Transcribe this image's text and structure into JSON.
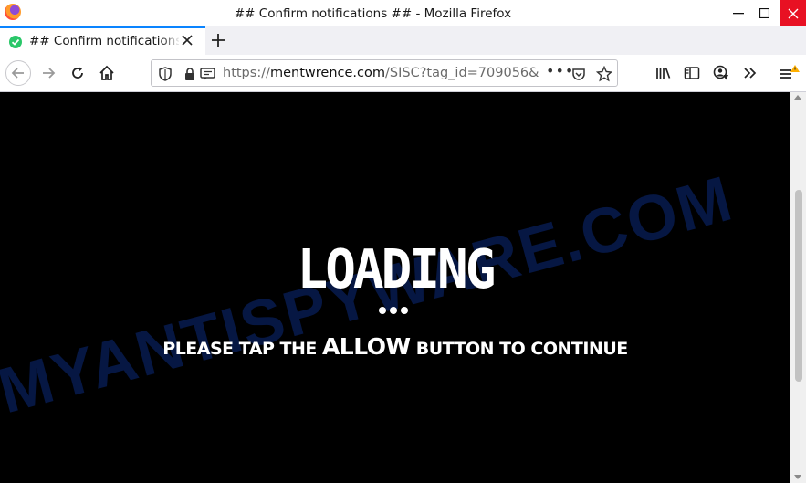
{
  "window": {
    "title": "## Confirm notifications ## - Mozilla Firefox",
    "controls": {
      "minimize": "—",
      "maximize": "☐",
      "close": "✕"
    }
  },
  "tab": {
    "title": "## Confirm notifications ##",
    "new_tab": "+"
  },
  "address": {
    "protocol": "https://",
    "domain": "mentwrence.com",
    "path": "/SISC?tag_id=709056&",
    "overflow_menu": "•••"
  },
  "page": {
    "loading": "LOADING",
    "tap_prefix": "PLEASE TAP THE ",
    "tap_emphasis": "ALLOW",
    "tap_suffix": " BUTTON TO CONTINUE"
  },
  "watermark": "MYANTISPYWARE.COM",
  "colors": {
    "accent": "#0a84ff",
    "close_red": "#e81123",
    "page_bg": "#000000",
    "tab_icon": "#2ac769",
    "alert": "#ffb000"
  },
  "icons": [
    "firefox-logo",
    "shield-check-icon",
    "close-icon",
    "plus-icon",
    "back-arrow-icon",
    "forward-arrow-icon",
    "reload-icon",
    "home-icon",
    "tracking-shield-icon",
    "lock-icon",
    "permission-icon",
    "pocket-icon",
    "star-icon",
    "library-icon",
    "sidebar-icon",
    "account-icon",
    "chevron-more-icon",
    "hamburger-menu-icon"
  ]
}
